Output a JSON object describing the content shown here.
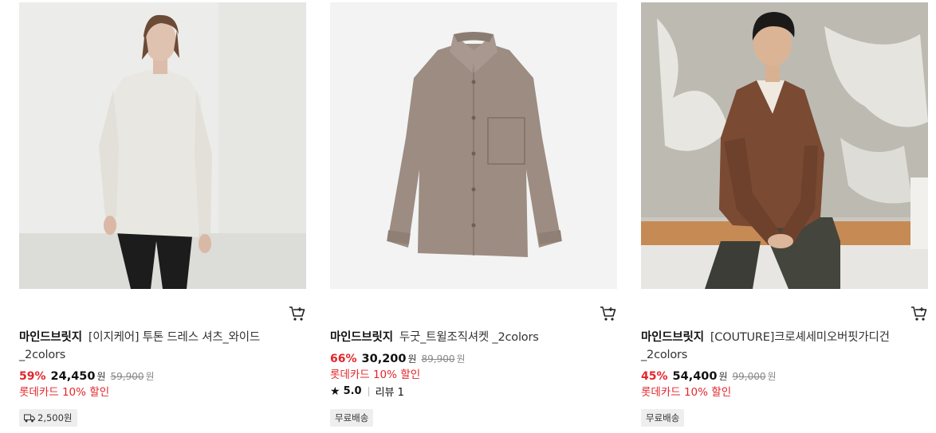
{
  "products": [
    {
      "brand": "마인드브릿지",
      "name_line1": "[이지케어] 투톤 드레스 셔츠_와이드",
      "name_line2": "_2colors",
      "discount_rate": "59%",
      "price": "24,450",
      "price_unit": "원",
      "original_price": "59,900",
      "original_unit": "원",
      "card_discount": "롯데카드 10% 할인",
      "shipping_label": "2,500원",
      "shipping_icon": "truck-icon"
    },
    {
      "brand": "마인드브릿지",
      "name_line1": "두굿_트윌조직셔켓 _2colors",
      "discount_rate": "66%",
      "price": "30,200",
      "price_unit": "원",
      "original_price": "89,900",
      "original_unit": "원",
      "card_discount": "롯데카드 10% 할인",
      "rating_score": "5.0",
      "review_label": "리뷰 1",
      "shipping_label": "무료배송"
    },
    {
      "brand": "마인드브릿지",
      "name_line1": "[COUTURE]크로셰세미오버핏가디건",
      "name_line2": "_2colors",
      "discount_rate": "45%",
      "price": "54,400",
      "price_unit": "원",
      "original_price": "99,000",
      "original_unit": "원",
      "card_discount": "롯데카드 10% 할인",
      "shipping_label": "무료배송"
    }
  ],
  "colors": {
    "discount_red": "#e3262c",
    "badge_bg": "#eeeeee"
  }
}
